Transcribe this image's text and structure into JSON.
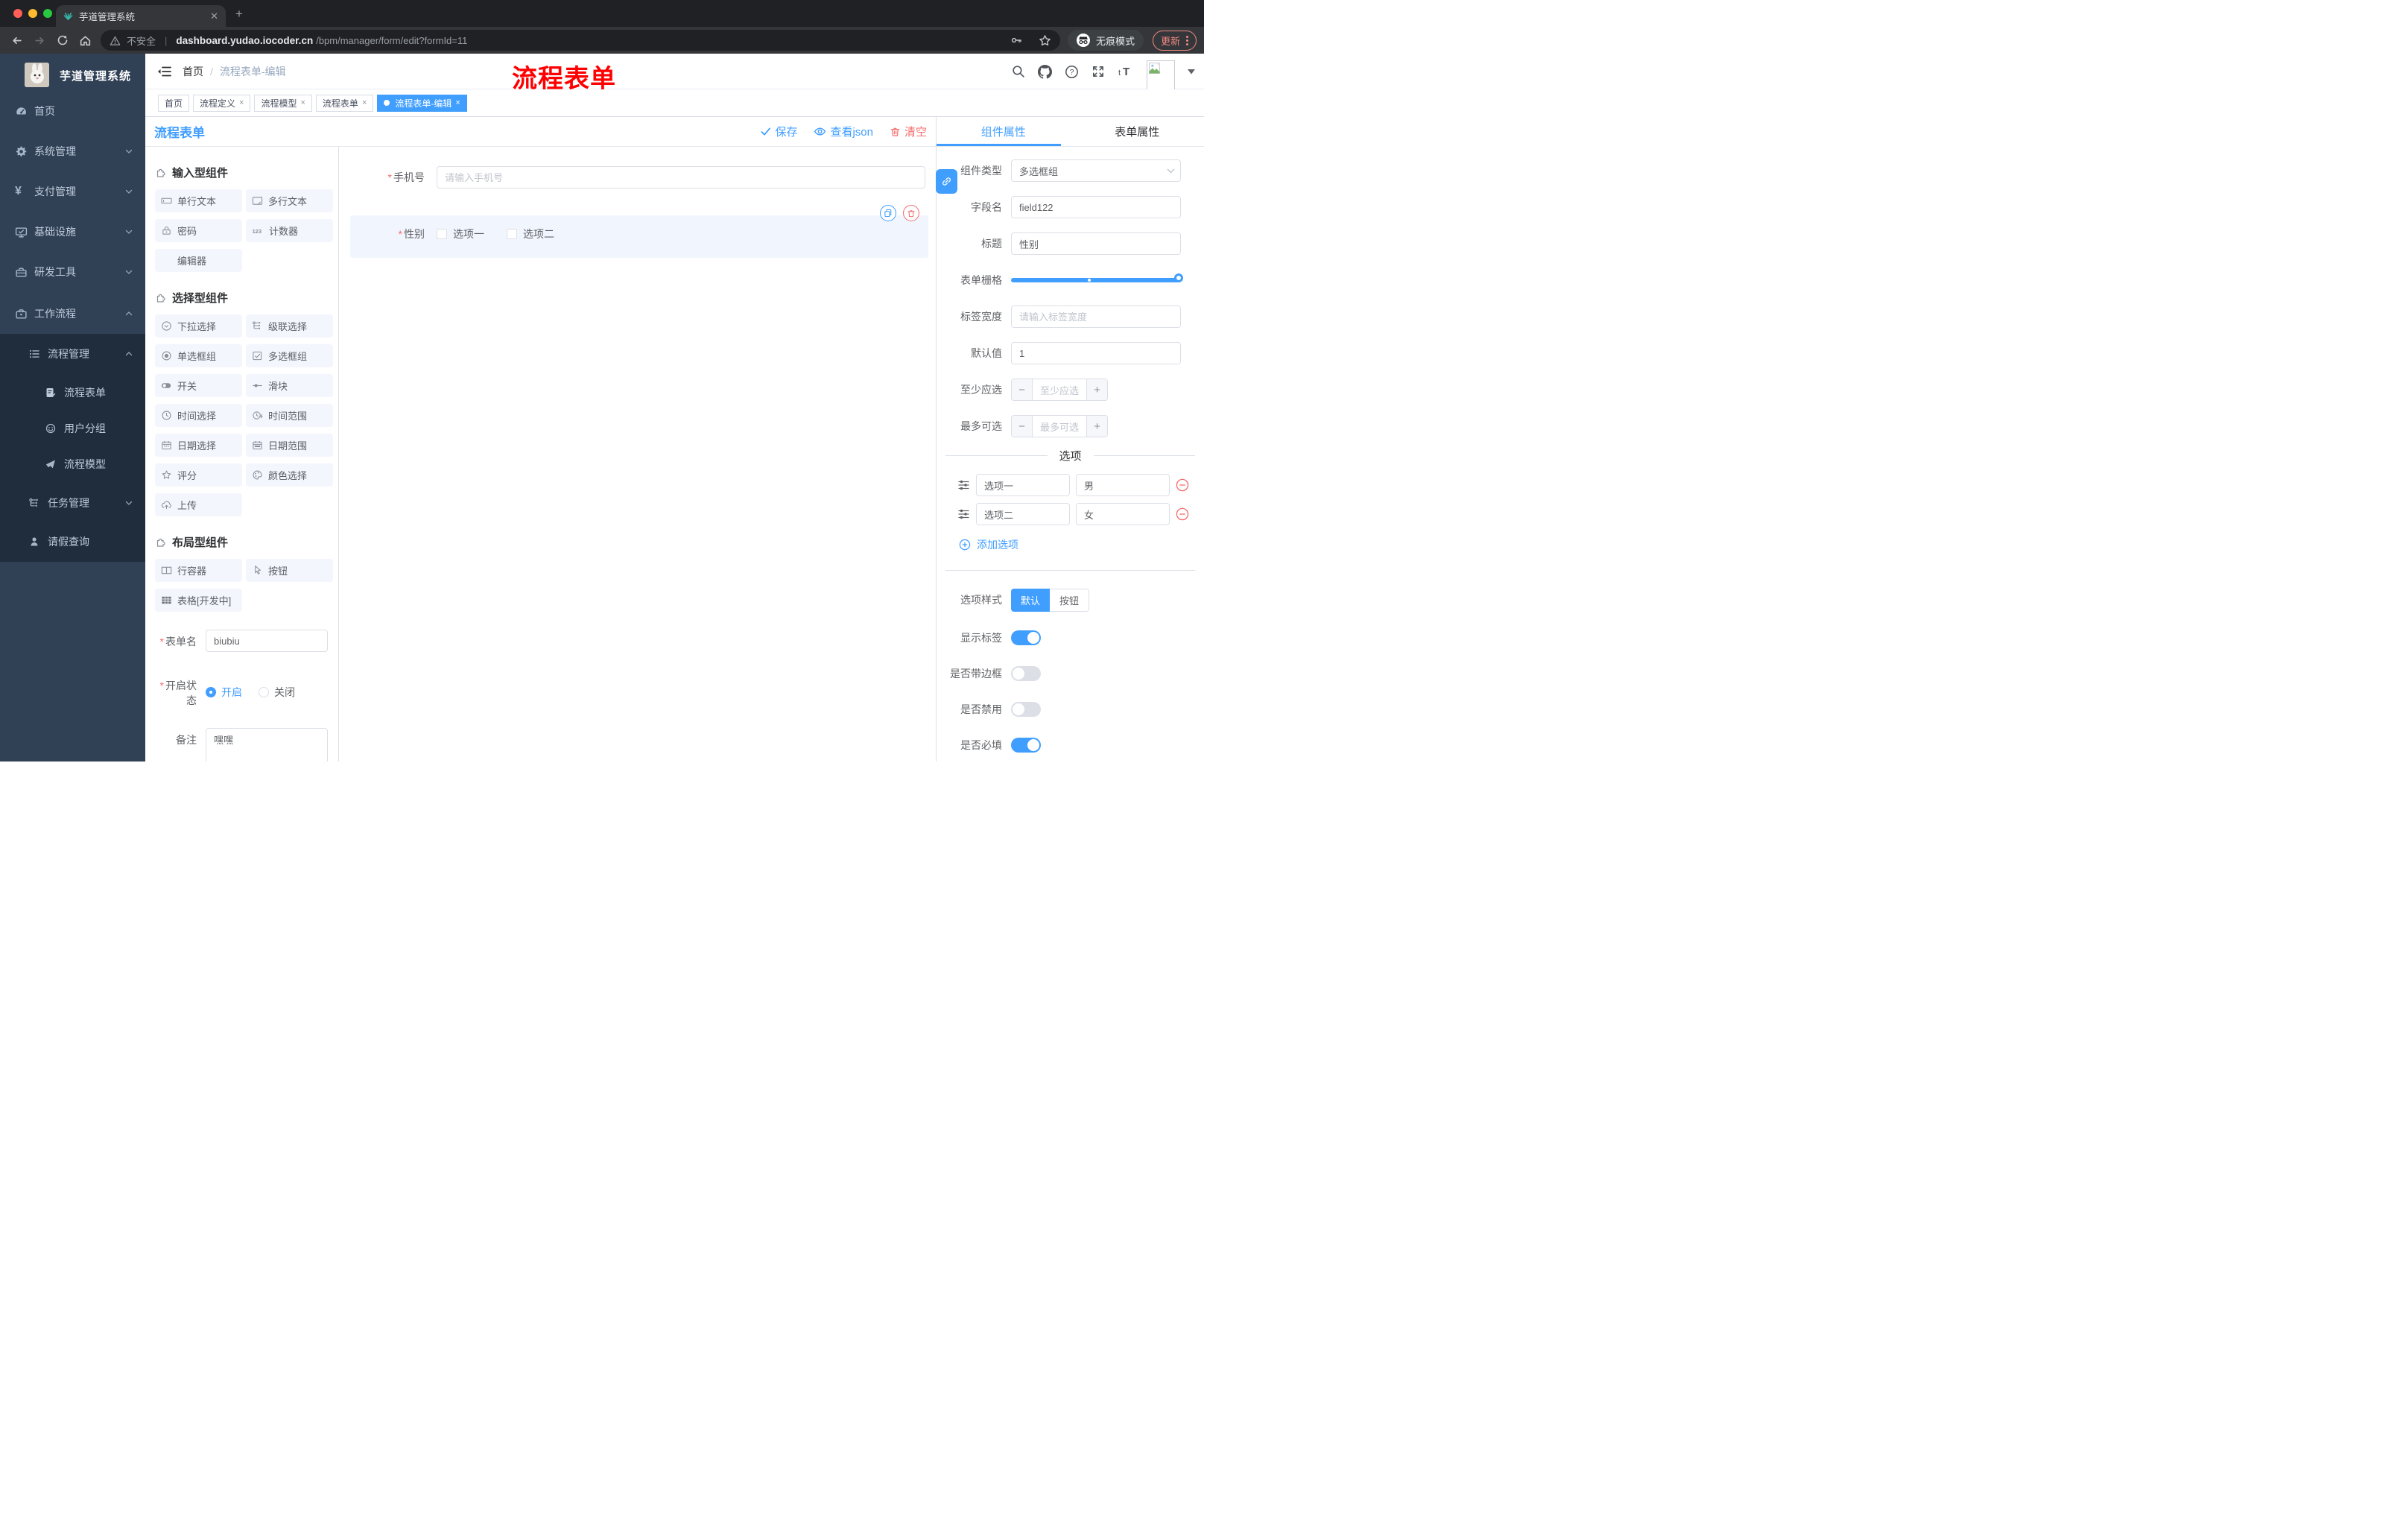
{
  "browser": {
    "tab_title": "芋道管理系统",
    "url_warning": "不安全",
    "url_domain": "dashboard.yudao.iocoder.cn",
    "url_path": "/bpm/manager/form/edit?formId=11",
    "incognito_label": "无痕模式",
    "update_label": "更新"
  },
  "sidebar": {
    "brand": "芋道管理系统",
    "home": "首页",
    "system": "系统管理",
    "payment": "支付管理",
    "infra": "基础设施",
    "devtools": "研发工具",
    "workflow": "工作流程",
    "process_mgmt": "流程管理",
    "process_form": "流程表单",
    "user_group": "用户分组",
    "process_model": "流程模型",
    "task_mgmt": "任务管理",
    "leave_query": "请假查询"
  },
  "header": {
    "breadcrumb_home": "首页",
    "breadcrumb_sep": "/",
    "breadcrumb_current": "流程表单-编辑",
    "watermark": "流程表单"
  },
  "tags": {
    "home": "首页",
    "t1": "流程定义",
    "t2": "流程模型",
    "t3": "流程表单",
    "active": "流程表单-编辑",
    "close": "×"
  },
  "toolbar": {
    "title": "流程表单",
    "save": "保存",
    "view_json": "查看json",
    "clear": "清空"
  },
  "palette": {
    "section_input": "输入型组件",
    "section_select": "选择型组件",
    "section_layout": "布局型组件",
    "input_items": [
      {
        "label": "单行文本",
        "icon": "single-line-text-icon"
      },
      {
        "label": "多行文本",
        "icon": "multi-line-text-icon"
      },
      {
        "label": "密码",
        "icon": "password-icon"
      },
      {
        "label": "计数器",
        "icon": "counter-icon"
      },
      {
        "label": "编辑器",
        "icon": "editor-icon"
      }
    ],
    "select_items": [
      {
        "label": "下拉选择",
        "icon": "dropdown-icon"
      },
      {
        "label": "级联选择",
        "icon": "cascader-icon"
      },
      {
        "label": "单选框组",
        "icon": "radio-group-icon"
      },
      {
        "label": "多选框组",
        "icon": "checkbox-group-icon"
      },
      {
        "label": "开关",
        "icon": "switch-icon"
      },
      {
        "label": "滑块",
        "icon": "slider-icon"
      },
      {
        "label": "时间选择",
        "icon": "time-icon"
      },
      {
        "label": "时间范围",
        "icon": "time-range-icon"
      },
      {
        "label": "日期选择",
        "icon": "date-icon"
      },
      {
        "label": "日期范围",
        "icon": "date-range-icon"
      },
      {
        "label": "评分",
        "icon": "rate-icon"
      },
      {
        "label": "颜色选择",
        "icon": "color-icon"
      },
      {
        "label": "上传",
        "icon": "upload-icon"
      }
    ],
    "layout_items": [
      {
        "label": "行容器",
        "icon": "row-container-icon"
      },
      {
        "label": "按钮",
        "icon": "button-icon"
      },
      {
        "label": "表格[开发中]",
        "icon": "table-icon"
      }
    ]
  },
  "canvas": {
    "phone": {
      "required": "*",
      "label": "手机号",
      "placeholder": "请输入手机号"
    },
    "gender": {
      "required": "*",
      "label": "性别",
      "option1": "选项一",
      "option2": "选项二"
    }
  },
  "bottom_form": {
    "required": "*",
    "name_label": "表单名",
    "name_value": "biubiu",
    "status_label": "开启状态",
    "status_on": "开启",
    "status_off": "关闭",
    "remark_label": "备注",
    "remark_value": "嘿嘿"
  },
  "panel": {
    "tab_component": "组件属性",
    "tab_form": "表单属性",
    "comp_type_label": "组件类型",
    "comp_type_value": "多选框组",
    "field_name_label": "字段名",
    "field_name_value": "field122",
    "title_label": "标题",
    "title_value": "性别",
    "grid_label": "表单栅格",
    "label_width_label": "标签宽度",
    "label_width_placeholder": "请输入标签宽度",
    "default_label": "默认值",
    "default_value": "1",
    "min_label": "至少应选",
    "min_placeholder": "至少应选",
    "max_label": "最多可选",
    "max_placeholder": "最多可选",
    "options_title": "选项",
    "options": [
      {
        "label": "选项一",
        "value": "男"
      },
      {
        "label": "选项二",
        "value": "女"
      }
    ],
    "add_option": "添加选项",
    "style_label": "选项样式",
    "style_default": "默认",
    "style_button": "按钮",
    "show_label_label": "显示标签",
    "border_label": "是否带边框",
    "disabled_label": "是否禁用",
    "required_label": "是否必填"
  },
  "colors": {
    "accent": "#409eff",
    "danger": "#f56c6c",
    "sidebar_bg": "#304156",
    "submenu_bg": "#1f2d3d"
  }
}
